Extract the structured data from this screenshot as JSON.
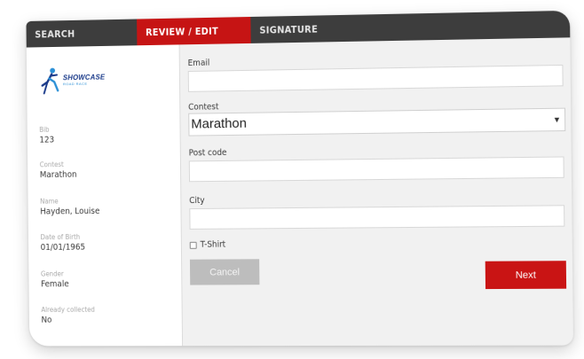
{
  "tabs": [
    {
      "label": "SEARCH",
      "active": false
    },
    {
      "label": "REVIEW / EDIT",
      "active": true
    },
    {
      "label": "SIGNATURE",
      "active": false
    }
  ],
  "logo": {
    "title": "SHOWCASE",
    "subtitle": "ROAD RACE"
  },
  "sidebar": {
    "fields": [
      {
        "label": "Bib",
        "value": "123"
      },
      {
        "label": "Contest",
        "value": "Marathon"
      },
      {
        "label": "Name",
        "value": "Hayden, Louise"
      },
      {
        "label": "Date of Birth",
        "value": "01/01/1965"
      },
      {
        "label": "Gender",
        "value": "Female"
      },
      {
        "label": "Already collected",
        "value": "No"
      }
    ]
  },
  "form": {
    "email_label": "Email",
    "email_value": "",
    "contest_label": "Contest",
    "contest_selected": "Marathon",
    "postcode_label": "Post code",
    "postcode_value": "",
    "city_label": "City",
    "city_value": "",
    "tshirt_label": "T-Shirt",
    "tshirt_checked": false
  },
  "buttons": {
    "cancel": "Cancel",
    "next": "Next"
  },
  "colors": {
    "accent_red": "#c91414",
    "tabbar": "#3d3d3d",
    "cancel_gray": "#bdbdbd"
  }
}
